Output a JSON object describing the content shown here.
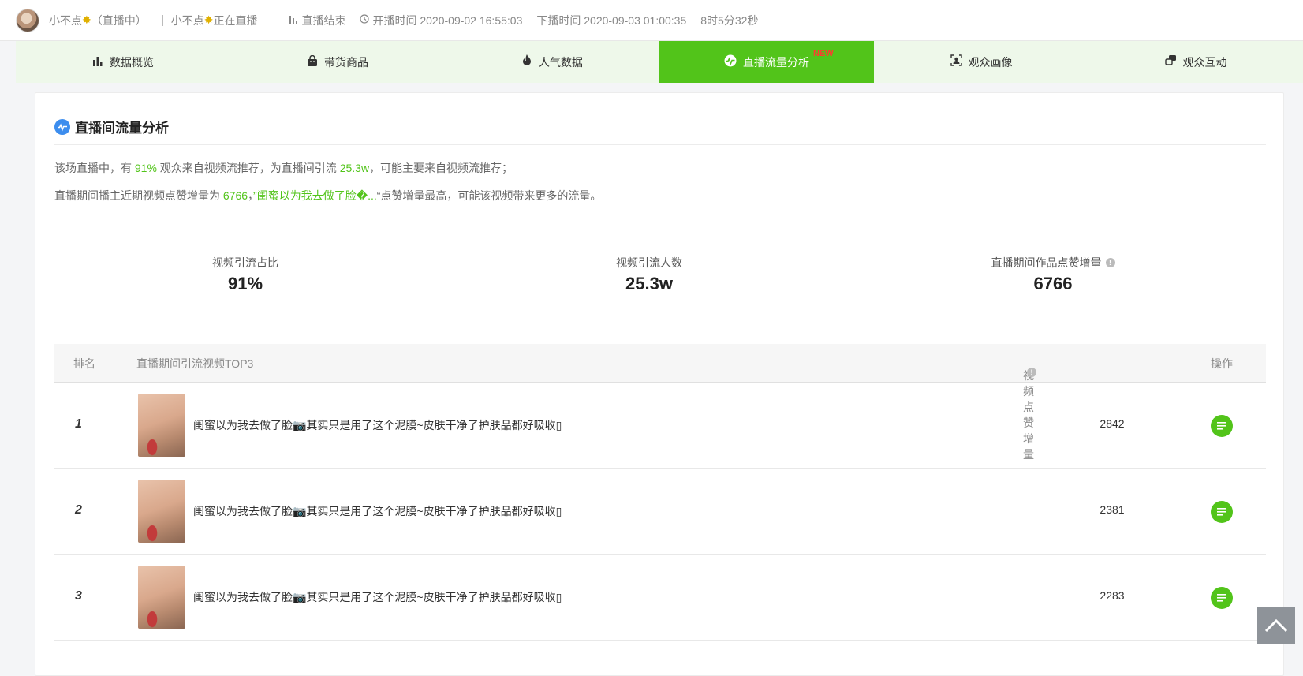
{
  "topbar": {
    "streamer_name": "小不点",
    "status_suffix": "（直播中）",
    "live_title_name": "小不点",
    "live_title_suffix": "正在直播",
    "live_state": "直播结束",
    "start_time": "开播时间 2020-09-02 16:55:03",
    "end_time": "下播时间 2020-09-03 01:00:35",
    "duration": "8时5分32秒"
  },
  "tabs": [
    {
      "label": "数据概览",
      "icon": "bar-chart-icon"
    },
    {
      "label": "带货商品",
      "icon": "shopping-bag-icon"
    },
    {
      "label": "人气数据",
      "icon": "flame-icon"
    },
    {
      "label": "直播流量分析",
      "icon": "pulse-icon",
      "active": true,
      "badge": "NEW"
    },
    {
      "label": "观众画像",
      "icon": "portrait-icon"
    },
    {
      "label": "观众互动",
      "icon": "interaction-icon"
    }
  ],
  "card": {
    "title": "直播间流量分析",
    "summary1": {
      "p1": "该场直播中，有 ",
      "v1": "91%",
      "p2": " 观众来自视频流推荐，为直播间引流 ",
      "v2": "25.3w",
      "p3": "，可能主要来自视频流推荐；"
    },
    "summary2": {
      "p1": "直播期间播主近期视频点赞增量为 ",
      "v1": "6766",
      "p2": "，",
      "v2": "”闺蜜以为我去做了脸�...",
      "p3": "“点赞增量最高，可能该视频带来更多的流量。"
    },
    "stats": [
      {
        "label": "视频引流占比",
        "value": "91%",
        "info": false
      },
      {
        "label": "视频引流人数",
        "value": "25.3w",
        "info": false
      },
      {
        "label": "直播期间作品点赞增量",
        "value": "6766",
        "info": true
      }
    ],
    "table": {
      "headers": {
        "rank": "排名",
        "video": "直播期间引流视频TOP3",
        "likes": "视频点赞增量",
        "op": "操作"
      },
      "rows": [
        {
          "rank": "1",
          "title": "闺蜜以为我去做了脸📷其实只是用了这个泥膜~皮肤干净了护肤品都好吸收▯",
          "likes": "2842"
        },
        {
          "rank": "2",
          "title": "闺蜜以为我去做了脸📷其实只是用了这个泥膜~皮肤干净了护肤品都好吸收▯",
          "likes": "2381"
        },
        {
          "rank": "3",
          "title": "闺蜜以为我去做了脸📷其实只是用了这个泥膜~皮肤干净了护肤品都好吸收▯",
          "likes": "2283"
        }
      ]
    }
  },
  "colors": {
    "accent": "#52c41a",
    "tab_bg": "#eef8ea",
    "icon_blue": "#3c8dee"
  }
}
